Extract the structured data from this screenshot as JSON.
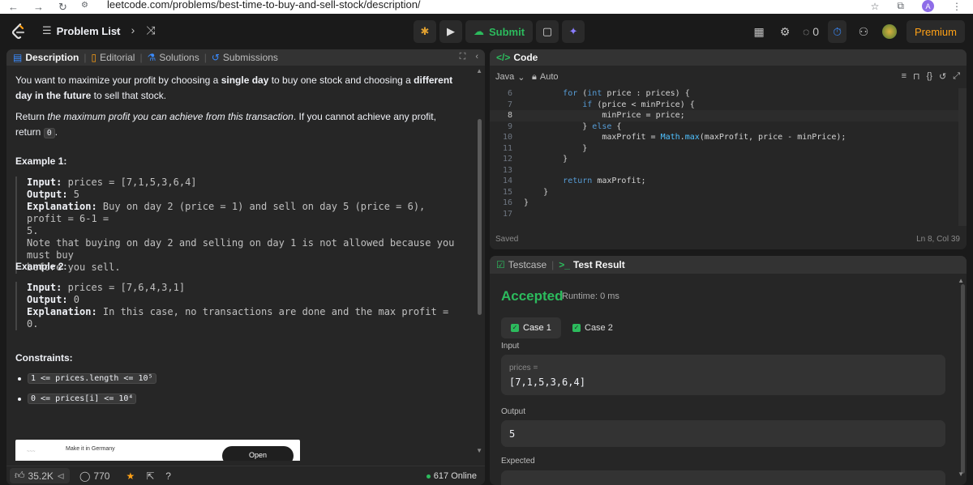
{
  "browser": {
    "url": "leetcode.com/problems/best-time-to-buy-and-sell-stock/description/",
    "profile_initial": "A"
  },
  "topnav": {
    "problem_list_label": "Problem List",
    "submit_label": "Submit",
    "streak_count": "0",
    "premium_label": "Premium"
  },
  "left_tabs": {
    "description": "Description",
    "editorial": "Editorial",
    "solutions": "Solutions",
    "submissions": "Submissions"
  },
  "description": {
    "p1_before": "You want to maximize your profit by choosing a ",
    "p1_bold1": "single day",
    "p1_mid": " to buy one stock and choosing a ",
    "p1_bold2": "different day in the future",
    "p1_after": " to sell that stock.",
    "p2_before": "Return ",
    "p2_italic": "the maximum profit you can achieve from this transaction",
    "p2_mid": ". If you cannot achieve any profit, return ",
    "p2_code": "0",
    "p2_after": "."
  },
  "example1": {
    "title": "Example 1:",
    "input_label": "Input:",
    "input_value": " prices = [7,1,5,3,6,4]",
    "output_label": "Output:",
    "output_value": " 5",
    "explanation_label": "Explanation:",
    "explanation_line1": " Buy on day 2 (price = 1) and sell on day 5 (price = 6), profit = 6-1 =",
    "explanation_line2": "5.",
    "note_line1": "Note that buying on day 2 and selling on day 1 is not allowed because you must buy",
    "note_line2": "before you sell."
  },
  "example2": {
    "title": "Example 2:",
    "input_label": "Input:",
    "input_value": " prices = [7,6,4,3,1]",
    "output_label": "Output:",
    "output_value": " 0",
    "explanation_label": "Explanation:",
    "explanation_value": " In this case, no transactions are done and the max profit = 0."
  },
  "constraints": {
    "title": "Constraints:",
    "items": [
      "1 <= prices.length <= 10⁵",
      "0 <= prices[i] <= 10⁴"
    ]
  },
  "ad": {
    "text": "Make it in Germany",
    "button": "Open"
  },
  "bottom_bar": {
    "likes": "35.2K",
    "comments": "770",
    "online": "617 Online"
  },
  "code_panel": {
    "title": "Code",
    "language": "Java",
    "mode": "Auto",
    "status": "Saved",
    "cursor": "Ln 8, Col 39",
    "lines": [
      {
        "n": "6",
        "text": "        for (int price : prices) {"
      },
      {
        "n": "7",
        "text": "            if (price < minPrice) {"
      },
      {
        "n": "8",
        "text": "                minPrice = price;"
      },
      {
        "n": "9",
        "text": "            } else {"
      },
      {
        "n": "10",
        "text": "                maxProfit = Math.max(maxProfit, price - minPrice);"
      },
      {
        "n": "11",
        "text": "            }"
      },
      {
        "n": "12",
        "text": "        }"
      },
      {
        "n": "13",
        "text": ""
      },
      {
        "n": "14",
        "text": "        return maxProfit;"
      },
      {
        "n": "15",
        "text": "    }"
      },
      {
        "n": "16",
        "text": "}"
      },
      {
        "n": "17",
        "text": ""
      }
    ]
  },
  "test_panel": {
    "tab_testcase": "Testcase",
    "tab_result": "Test Result",
    "verdict": "Accepted",
    "runtime": "Runtime: 0 ms",
    "case1": "Case 1",
    "case2": "Case 2",
    "input_label": "Input",
    "input_var": "prices =",
    "input_value": "[7,1,5,3,6,4]",
    "output_label": "Output",
    "output_value": "5",
    "expected_label": "Expected"
  },
  "colors": {
    "accent_green": "#2cbb5d",
    "premium_orange": "#ffa116",
    "panel_bg": "#262626",
    "page_bg": "#1a1a1a"
  }
}
